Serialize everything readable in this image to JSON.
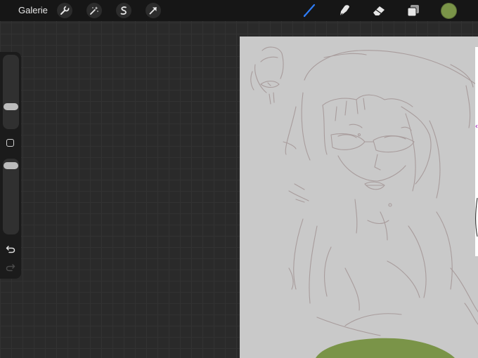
{
  "topbar": {
    "gallery_label": "Galerie",
    "left_tools": [
      "wrench-icon",
      "magic-wand-icon",
      "selection-icon",
      "move-arrow-icon"
    ],
    "right_tools": [
      "brush-icon",
      "smudge-icon",
      "eraser-icon",
      "layers-icon"
    ],
    "active_tool": "brush-icon",
    "active_color": "#7a9448",
    "accent_color": "#2e7cf6"
  },
  "sidebar": {
    "size_slider_value": 0.4,
    "opacity_slider_value": 0.05,
    "modifier_button": "square-button",
    "undo_icon": "undo-icon",
    "redo_icon": "redo-icon"
  },
  "canvas": {
    "background_color": "#c9c9c9",
    "sketch_line_color": "#a89c9c",
    "fill_color": "#7a9448"
  }
}
